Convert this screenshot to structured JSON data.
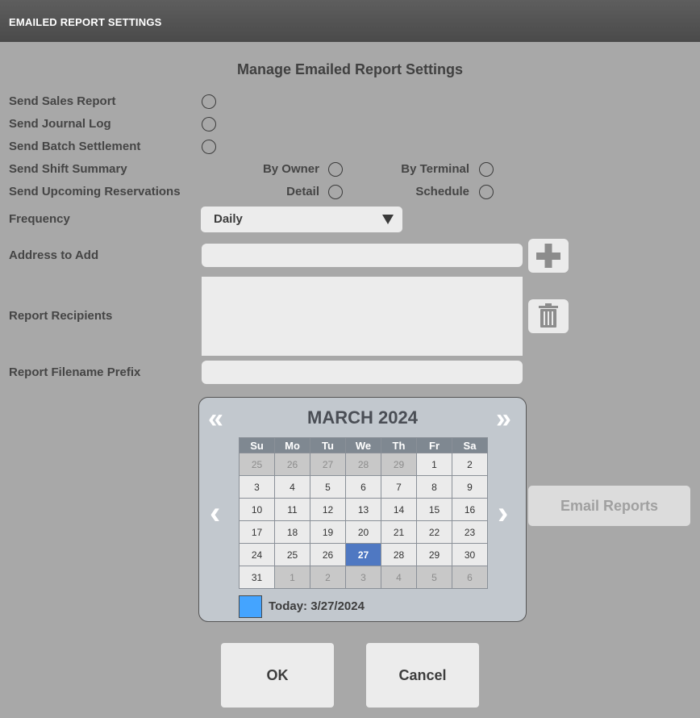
{
  "window": {
    "title": "EMAILED REPORT SETTINGS"
  },
  "heading": "Manage Emailed Report Settings",
  "options": {
    "sales": "Send Sales Report",
    "journal": "Send Journal Log",
    "batch": "Send Batch Settlement",
    "shift": "Send Shift Summary",
    "reservations": "Send Upcoming Reservations",
    "by_owner": "By Owner",
    "by_terminal": "By Terminal",
    "detail": "Detail",
    "schedule": "Schedule"
  },
  "frequency": {
    "label": "Frequency",
    "value": "Daily"
  },
  "address": {
    "label": "Address to Add",
    "value": ""
  },
  "recipients": {
    "label": "Report Recipients",
    "items": []
  },
  "prefix": {
    "label": "Report Filename Prefix",
    "value": ""
  },
  "calendar": {
    "month_label": "MARCH 2024",
    "days": [
      "Su",
      "Mo",
      "Tu",
      "We",
      "Th",
      "Fr",
      "Sa"
    ],
    "weeks": [
      [
        [
          "25",
          true
        ],
        [
          "26",
          true
        ],
        [
          "27",
          true
        ],
        [
          "28",
          true
        ],
        [
          "29",
          true
        ],
        [
          "1",
          false
        ],
        [
          "2",
          false
        ]
      ],
      [
        [
          "3",
          false
        ],
        [
          "4",
          false
        ],
        [
          "5",
          false
        ],
        [
          "6",
          false
        ],
        [
          "7",
          false
        ],
        [
          "8",
          false
        ],
        [
          "9",
          false
        ]
      ],
      [
        [
          "10",
          false
        ],
        [
          "11",
          false
        ],
        [
          "12",
          false
        ],
        [
          "13",
          false
        ],
        [
          "14",
          false
        ],
        [
          "15",
          false
        ],
        [
          "16",
          false
        ]
      ],
      [
        [
          "17",
          false
        ],
        [
          "18",
          false
        ],
        [
          "19",
          false
        ],
        [
          "20",
          false
        ],
        [
          "21",
          false
        ],
        [
          "22",
          false
        ],
        [
          "23",
          false
        ]
      ],
      [
        [
          "24",
          false
        ],
        [
          "25",
          false
        ],
        [
          "26",
          false
        ],
        [
          "27",
          false
        ],
        [
          "28",
          false
        ],
        [
          "29",
          false
        ],
        [
          "30",
          false
        ]
      ],
      [
        [
          "31",
          false
        ],
        [
          "1",
          true
        ],
        [
          "2",
          true
        ],
        [
          "3",
          true
        ],
        [
          "4",
          true
        ],
        [
          "5",
          true
        ],
        [
          "6",
          true
        ]
      ]
    ],
    "selected": "27",
    "today_label": "Today:  3/27/2024",
    "prev_year": "«",
    "next_year": "»",
    "prev_month": "‹",
    "next_month": "›"
  },
  "buttons": {
    "email": "Email Reports",
    "ok": "OK",
    "cancel": "Cancel"
  },
  "icons": {
    "add": "plus-icon",
    "delete": "trash-icon"
  }
}
